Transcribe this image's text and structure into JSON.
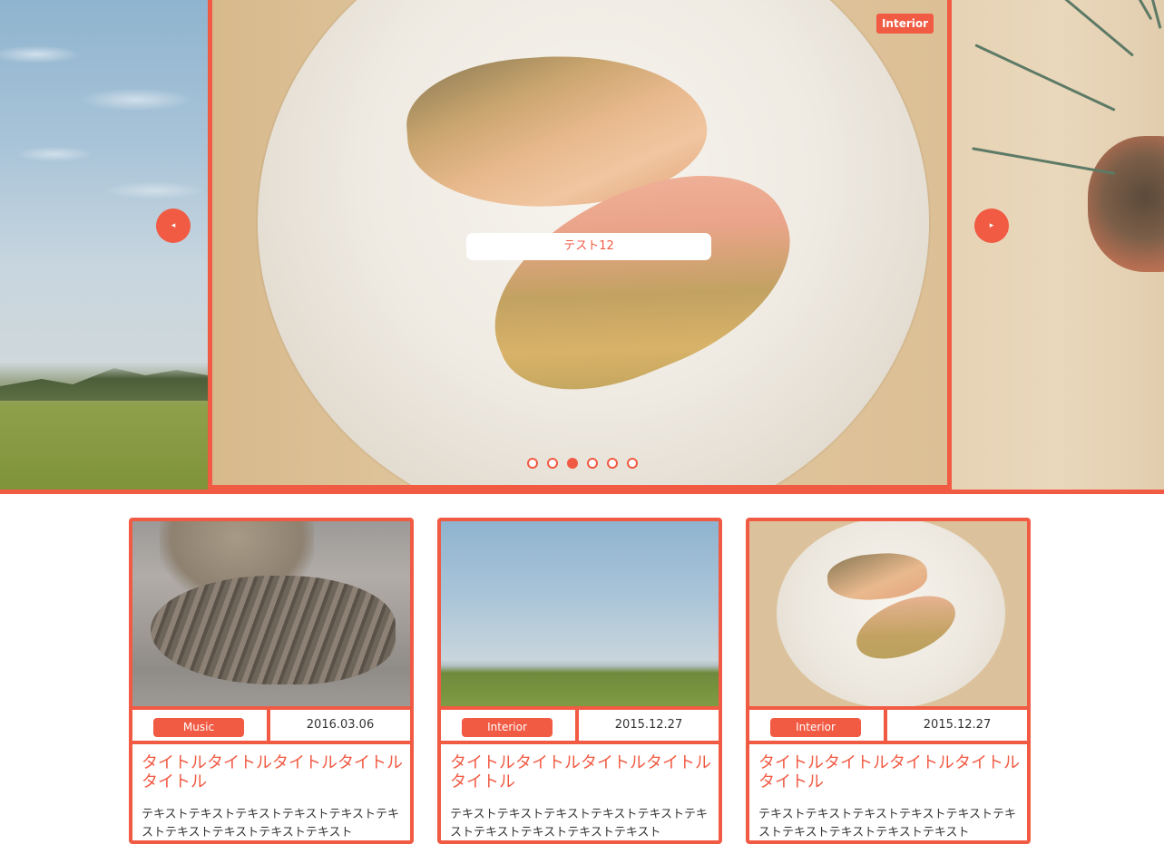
{
  "slider": {
    "badge": "Interior",
    "caption": "テスト12",
    "prev_icon": "◂",
    "next_icon": "▸",
    "dots_count": 6,
    "active_dot": 3,
    "accent_color": "#f15a43"
  },
  "cards": [
    {
      "image": "cat-photo",
      "category": "Music",
      "date": "2016.03.06",
      "title": "タイトルタイトルタイトルタイトルタイトル",
      "body": "テキストテキストテキストテキストテキストテキストテキストテキストテキストテキスト"
    },
    {
      "image": "rice-field-photo",
      "category": "Interior",
      "date": "2015.12.27",
      "title": "タイトルタイトルタイトルタイトルタイトル",
      "body": "テキストテキストテキストテキストテキストテキストテキストテキストテキストテキスト"
    },
    {
      "image": "grilled-salmon-photo",
      "category": "Interior",
      "date": "2015.12.27",
      "title": "タイトルタイトルタイトルタイトルタイトル",
      "body": "テキストテキストテキストテキストテキストテキストテキストテキストテキストテキスト"
    }
  ]
}
